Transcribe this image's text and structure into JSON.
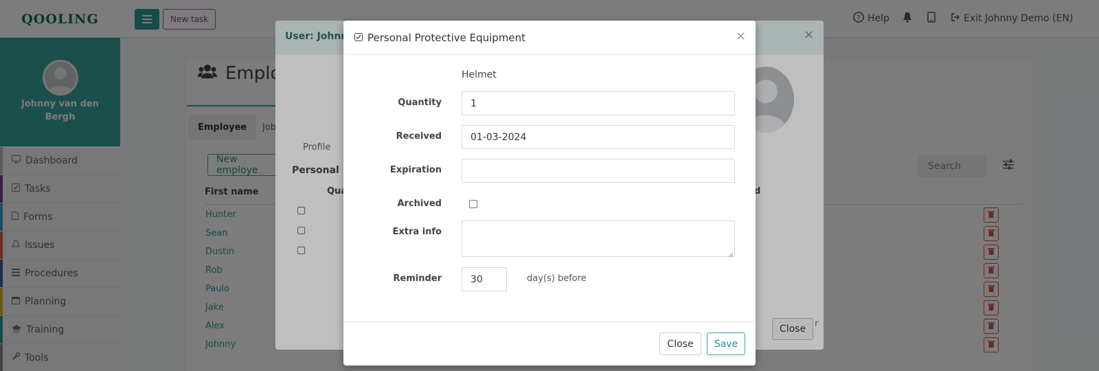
{
  "header": {
    "logo": "QOOLING",
    "new_task": "New task",
    "help": "Help",
    "exit": "Exit Johnny Demo (EN)"
  },
  "sidebar": {
    "user_name": "Johnny van den Bergh",
    "items": [
      {
        "label": "Dashboard",
        "icon": "monitor-icon",
        "color": "#bbbbbb"
      },
      {
        "label": "Tasks",
        "icon": "check-square-icon",
        "color": "#7a3f93"
      },
      {
        "label": "Forms",
        "icon": "file-icon",
        "color": "#3a9fd5"
      },
      {
        "label": "Issues",
        "icon": "bell-icon",
        "color": "#e2604b"
      },
      {
        "label": "Procedures",
        "icon": "list-icon",
        "color": "#3f5fa8"
      },
      {
        "label": "Planning",
        "icon": "calendar-icon",
        "color": "#e2b21f"
      },
      {
        "label": "Training",
        "icon": "graduation-cap-icon",
        "color": "#2b9c94"
      },
      {
        "label": "Tools",
        "icon": "wrench-icon",
        "color": "#888888"
      }
    ]
  },
  "page": {
    "title": "Employ",
    "tabs": [
      "Employee",
      "Job"
    ],
    "new_employee_btn": "New employe",
    "search_placeholder": "Search",
    "col_first_name": "First name",
    "col_d": "d",
    "employees": [
      "Hunter",
      "Sean",
      "Dustin",
      "Rob",
      "Paulo",
      "Jake",
      "Alex",
      "Johnny"
    ],
    "partial_link": "r"
  },
  "user_modal": {
    "title": "User: Johnny",
    "tab_profile": "Profile",
    "section": "Personal Pr",
    "col_qua": "Qua",
    "close": "Close"
  },
  "ppe_modal": {
    "title": "Personal Protective Equipment",
    "item": "Helmet",
    "quantity_label": "Quantity",
    "quantity": "1",
    "received_label": "Received",
    "received": "01-03-2024",
    "expiration_label": "Expiration",
    "expiration": "",
    "archived_label": "Archived",
    "extra_info_label": "Extra info",
    "extra_info": "",
    "reminder_label": "Reminder",
    "reminder": "30",
    "reminder_suffix": "day(s) before",
    "close": "Close",
    "save": "Save"
  }
}
